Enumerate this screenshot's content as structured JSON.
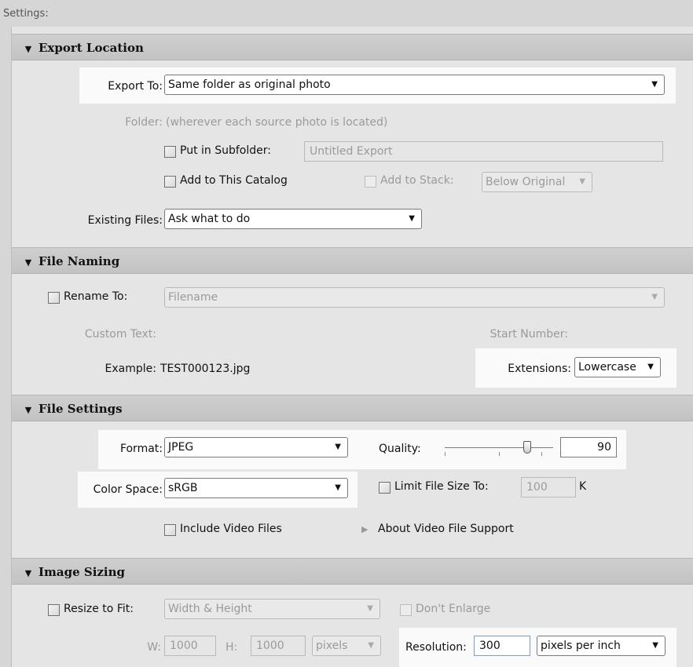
{
  "settings_label": "Settings:",
  "sections": {
    "export_location": "Export Location",
    "file_naming": "File Naming",
    "file_settings": "File Settings",
    "image_sizing": "Image Sizing"
  },
  "export_location": {
    "export_to_label": "Export To:",
    "export_to_value": "Same folder as original photo",
    "folder_label": "Folder:",
    "folder_value": "(wherever each source photo is located)",
    "subfolder_label": "Put in Subfolder:",
    "subfolder_value": "Untitled Export",
    "add_catalog_label": "Add to This Catalog",
    "add_stack_label": "Add to Stack:",
    "stack_value": "Below Original",
    "existing_files_label": "Existing Files:",
    "existing_files_value": "Ask what to do"
  },
  "file_naming": {
    "rename_label": "Rename To:",
    "rename_value": "Filename",
    "custom_text_label": "Custom Text:",
    "start_number_label": "Start Number:",
    "example_label": "Example:",
    "example_value": "TEST000123.jpg",
    "extensions_label": "Extensions:",
    "extensions_value": "Lowercase"
  },
  "file_settings": {
    "format_label": "Format:",
    "format_value": "JPEG",
    "quality_label": "Quality:",
    "quality_value": "90",
    "quality_fraction": 0.9,
    "color_space_label": "Color Space:",
    "color_space_value": "sRGB",
    "limit_size_label": "Limit File Size To:",
    "limit_size_value": "100",
    "limit_size_unit": "K",
    "include_video_label": "Include Video Files",
    "about_video_label": "About Video File Support"
  },
  "image_sizing": {
    "resize_label": "Resize to Fit:",
    "resize_value": "Width & Height",
    "dont_enlarge_label": "Don't Enlarge",
    "w_label": "W:",
    "w_value": "1000",
    "h_label": "H:",
    "h_value": "1000",
    "units_value": "pixels",
    "resolution_label": "Resolution:",
    "resolution_value": "300",
    "resolution_unit": "pixels per inch"
  }
}
